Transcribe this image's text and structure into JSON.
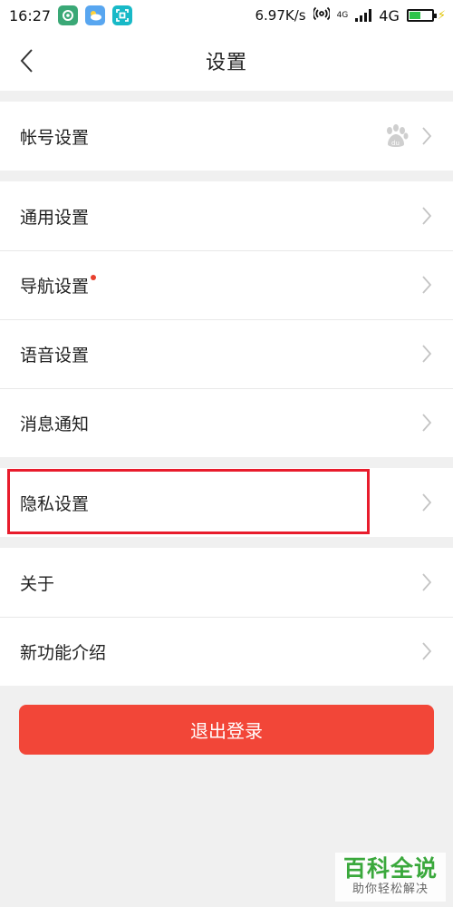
{
  "status_bar": {
    "time": "16:27",
    "net_speed": "6.97K/s",
    "network_small": "4G",
    "network": "4G",
    "battery_level": 0.45,
    "icons": [
      "app-green-icon",
      "weather-icon",
      "scan-icon",
      "hotspot-icon",
      "signal-icon",
      "battery-icon"
    ]
  },
  "header": {
    "title": "设置",
    "back_icon": "chevron-left-icon"
  },
  "groups": {
    "account": {
      "items": [
        {
          "label": "帐号设置",
          "logo": "baidu-paw-logo"
        }
      ]
    },
    "general": {
      "items": [
        {
          "label": "通用设置"
        },
        {
          "label": "导航设置",
          "badge": "red-dot"
        },
        {
          "label": "语音设置"
        },
        {
          "label": "消息通知"
        }
      ]
    },
    "privacy": {
      "items": [
        {
          "label": "隐私设置",
          "highlighted": true
        }
      ]
    },
    "about": {
      "items": [
        {
          "label": "关于"
        },
        {
          "label": "新功能介绍"
        }
      ]
    }
  },
  "logout": {
    "label": "退出登录",
    "color": "#f24638"
  },
  "annotation": {
    "highlight_color": "#e81c2c"
  },
  "watermark": {
    "title": "百科全说",
    "subtitle": "助你轻松解决"
  }
}
